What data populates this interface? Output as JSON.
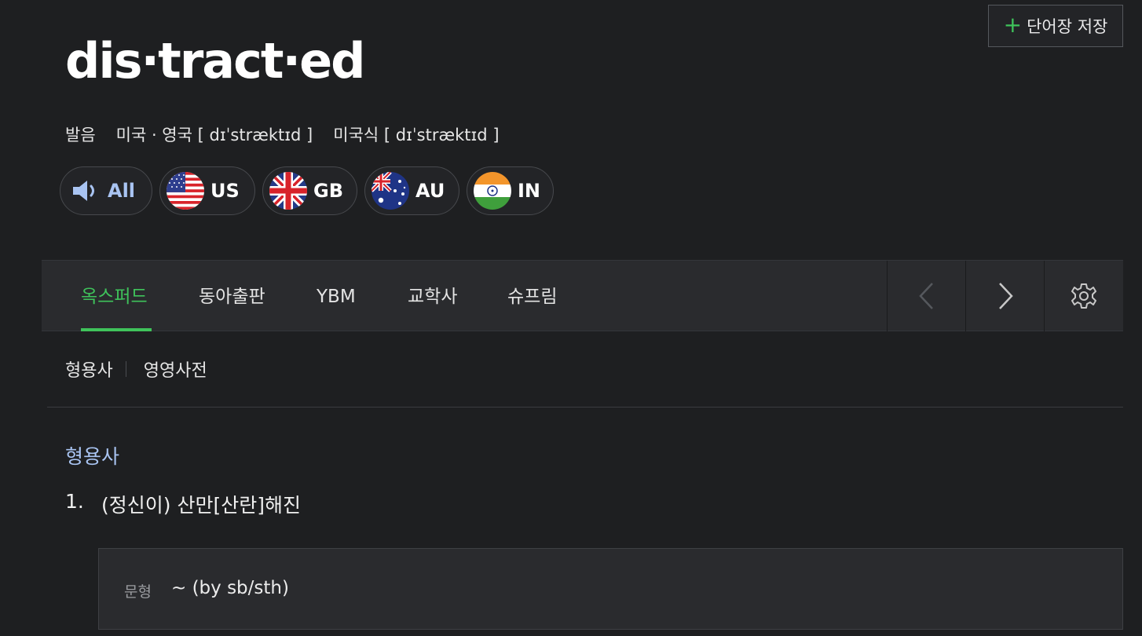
{
  "header": {
    "save_button_label": "단어장 저장",
    "headword": "dis·tract·ed"
  },
  "pronunciation": {
    "label": "발음",
    "variants": [
      {
        "region": "미국 · 영국",
        "ipa": "[ dɪˈstræktɪd ]"
      },
      {
        "region": "미국식",
        "ipa": "[ dɪˈstræktɪd ]"
      }
    ]
  },
  "audio_buttons": [
    {
      "code": "All",
      "icon": "speaker-icon"
    },
    {
      "code": "US",
      "icon": "us-flag-icon"
    },
    {
      "code": "GB",
      "icon": "gb-flag-icon"
    },
    {
      "code": "AU",
      "icon": "au-flag-icon"
    },
    {
      "code": "IN",
      "icon": "in-flag-icon"
    }
  ],
  "tabs": [
    {
      "label": "옥스퍼드",
      "active": true
    },
    {
      "label": "동아출판",
      "active": false
    },
    {
      "label": "YBM",
      "active": false
    },
    {
      "label": "교학사",
      "active": false
    },
    {
      "label": "슈프림",
      "active": false
    }
  ],
  "tab_nav": {
    "prev_icon": "chevron-left-icon",
    "next_icon": "chevron-right-icon",
    "settings_icon": "gear-icon"
  },
  "subtabs": [
    "형용사",
    "영영사전"
  ],
  "entry": {
    "part_of_speech": "형용사",
    "senses": [
      {
        "number": "1.",
        "definition": "(정신이) 산만[산란]해진"
      }
    ],
    "pattern": {
      "label": "문형",
      "value": "~ (by sb/sth)"
    }
  },
  "colors": {
    "background": "#1e1f21",
    "accent_green": "#3fc35b",
    "accent_blue": "#a9c4f2",
    "panel": "#2a2b2e"
  }
}
